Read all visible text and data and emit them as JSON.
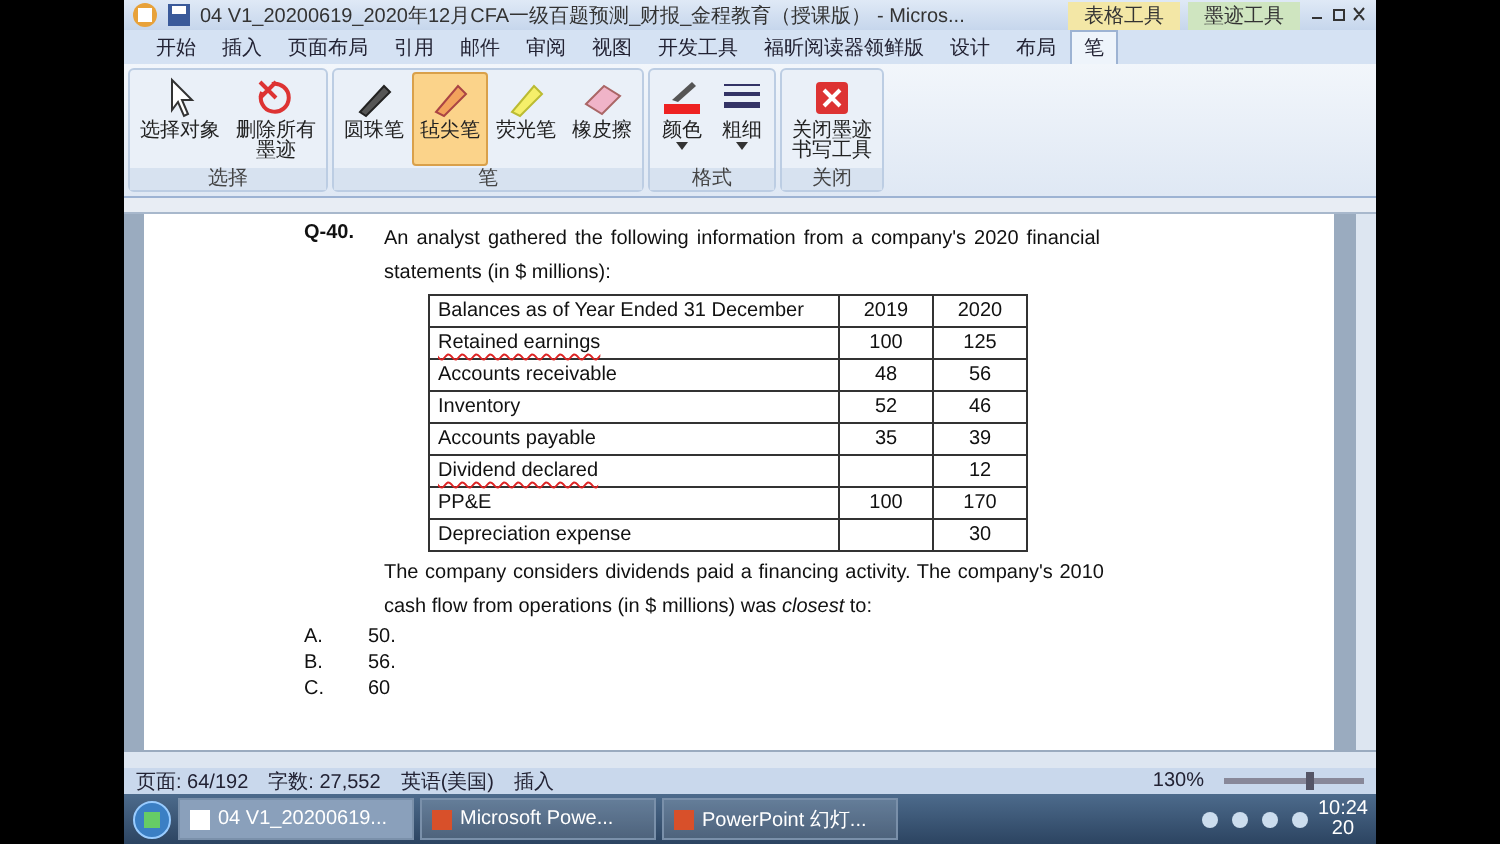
{
  "window": {
    "title": "04 V1_20200619_2020年12月CFA一级百题预测_财报_金程教育（授课版） - Micros...",
    "context_tabs": [
      "表格工具",
      "墨迹工具"
    ]
  },
  "tabs": [
    {
      "label": "开始",
      "selected": false
    },
    {
      "label": "插入",
      "selected": false
    },
    {
      "label": "页面布局",
      "selected": false
    },
    {
      "label": "引用",
      "selected": false
    },
    {
      "label": "邮件",
      "selected": false
    },
    {
      "label": "审阅",
      "selected": false
    },
    {
      "label": "视图",
      "selected": false
    },
    {
      "label": "开发工具",
      "selected": false
    },
    {
      "label": "福昕阅读器领鲜版",
      "selected": false
    },
    {
      "label": "设计",
      "selected": false
    },
    {
      "label": "布局",
      "selected": false
    },
    {
      "label": "笔",
      "selected": true
    }
  ],
  "ribbon": [
    {
      "group": "选择",
      "buttons": [
        {
          "label": "选择对象",
          "selected": false,
          "dropdown": false
        },
        {
          "label": "删除所有墨迹",
          "selected": false,
          "dropdown": false
        }
      ]
    },
    {
      "group": "笔",
      "buttons": [
        {
          "label": "圆珠笔",
          "selected": false,
          "dropdown": false
        },
        {
          "label": "毡尖笔",
          "selected": true,
          "dropdown": false
        },
        {
          "label": "荧光笔",
          "selected": false,
          "dropdown": false
        },
        {
          "label": "橡皮擦",
          "selected": false,
          "dropdown": false
        }
      ]
    },
    {
      "group": "格式",
      "buttons": [
        {
          "label": "颜色",
          "selected": false,
          "dropdown": true
        },
        {
          "label": "粗细",
          "selected": false,
          "dropdown": true
        }
      ]
    },
    {
      "group": "关闭",
      "buttons": [
        {
          "label": "关闭墨迹书写工具",
          "selected": false,
          "dropdown": false
        }
      ]
    }
  ],
  "document": {
    "question_number": "Q-40.",
    "intro": "An analyst gathered the following information from a company's 2020 financial statements (in $ millions):",
    "table": {
      "columns": [
        "Balances as of Year Ended 31 December",
        "2019",
        "2020"
      ],
      "rows": [
        {
          "label": "Retained earnings",
          "misspelled": true,
          "y2019": "100",
          "y2020": "125"
        },
        {
          "label": "Accounts receivable",
          "misspelled": false,
          "y2019": "48",
          "y2020": "56"
        },
        {
          "label": "Inventory",
          "misspelled": false,
          "y2019": "52",
          "y2020": "46"
        },
        {
          "label": "Accounts payable",
          "misspelled": false,
          "y2019": "35",
          "y2020": "39"
        },
        {
          "label": "Dividend declared",
          "misspelled": true,
          "y2020": "12"
        },
        {
          "label": "PP&E",
          "misspelled": false,
          "y2019": "100",
          "y2020": "170"
        },
        {
          "label": "Depreciation expense",
          "misspelled": false,
          "y2020": "30"
        }
      ]
    },
    "question": "The company considers dividends paid a financing activity. The company's 2010 cash flow from operations (in $ millions) was *closest* to:",
    "options": [
      {
        "letter": "A.",
        "text": "50."
      },
      {
        "letter": "B.",
        "text": "56."
      },
      {
        "letter": "C.",
        "text": "60"
      }
    ]
  },
  "status_bar": {
    "items": [
      "页面: 64/192",
      "字数: 27,552",
      "英语(美国)",
      "插入"
    ],
    "zoom": "130%",
    "zoom_slider": {
      "level": 0.62
    }
  },
  "taskbar": {
    "apps": [
      {
        "label": "04 V1_20200619...",
        "selected": true
      },
      {
        "label": "Microsoft Powe...",
        "selected": false
      },
      {
        "label": "PowerPoint 幻灯...",
        "selected": false
      }
    ],
    "time": "10:24",
    "date": "20"
  }
}
